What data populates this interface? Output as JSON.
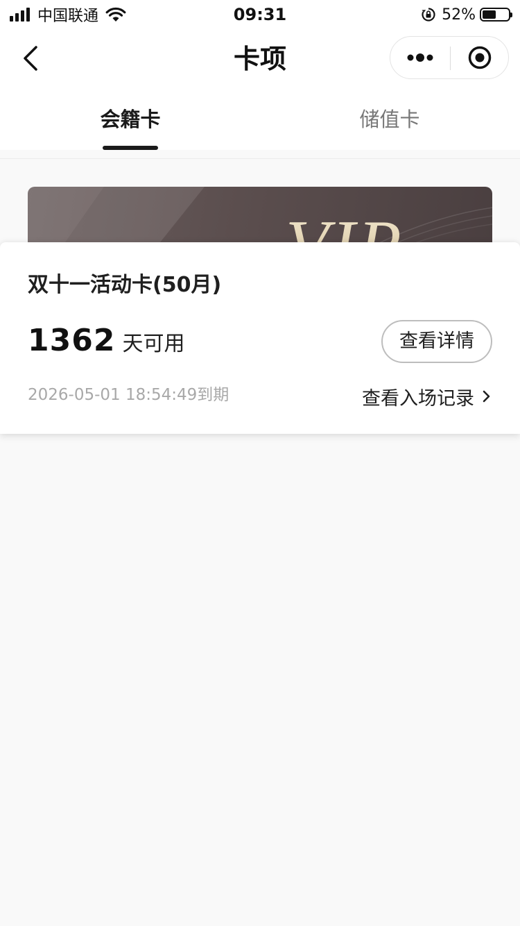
{
  "status_bar": {
    "carrier": "中国联通",
    "time": "09:31",
    "battery_percent": "52%",
    "battery_level": 0.52,
    "signal_icon": "signal-bars-icon",
    "wifi_icon": "wifi-icon",
    "rotation_lock_icon": "rotation-lock-icon"
  },
  "nav": {
    "title": "卡项",
    "back_icon": "chevron-left-icon",
    "more_icon": "more-dots-icon",
    "close_icon": "target-close-icon"
  },
  "tabs": [
    {
      "label": "会籍卡",
      "active": true
    },
    {
      "label": "储值卡",
      "active": false
    }
  ],
  "card": {
    "banner_text": "VIP",
    "name": "双十一活动卡(50月)",
    "days_value": "1362",
    "days_suffix": "天可用",
    "detail_button": "查看详情",
    "expiry": "2026-05-01 18:54:49到期",
    "records_link": "查看入场记录"
  },
  "colors": {
    "accent_dark": "#1a1a1a",
    "card_banner": "#5b4e4e",
    "vip_gold": "#e9d8b4",
    "muted_text": "#a8a8a8",
    "page_background": "#f9f9f9"
  }
}
